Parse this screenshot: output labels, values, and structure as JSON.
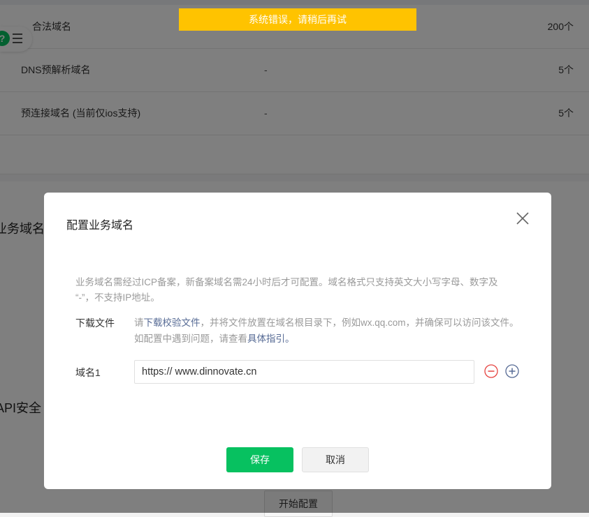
{
  "toast": {
    "text": "系统错误，请稍后再试",
    "color": "#ffc300"
  },
  "domain_table": {
    "rows": [
      {
        "name": "合法域名",
        "value": "",
        "count": "200个"
      },
      {
        "name": "DNS预解析域名",
        "value": "-",
        "count": "5个"
      },
      {
        "name": "预连接域名 (当前仅ios支持)",
        "value": "-",
        "count": "5个"
      }
    ]
  },
  "sections": {
    "business_domain_title": "业务域名",
    "api_security_title": "API安全"
  },
  "start_config_button": "开始配置",
  "help_float": {
    "icon": "question-icon",
    "menu_icon": "menu-icon"
  },
  "dialog": {
    "title": "配置业务域名",
    "notice_line1": "业务域名需经过ICP备案，新备案域名需24小时后才可配置。域名格式只支持英文大小写字母、数字及",
    "notice_line2": "“-”，不支持IP地址。",
    "download_label": "下载文件",
    "download_desc_prefix": "请",
    "download_link": "下载校验文件",
    "download_desc_middle": "，并将文件放置在域名根目录下，例如wx.qq.com，并确保可以访问该文件。如配置中遇到问题，请查看",
    "guide_link": "具体指引",
    "download_desc_suffix": "。",
    "domain_label": "域名1",
    "domain_value": "https:// www.dinnovate.cn",
    "save_label": "保存",
    "cancel_label": "取消",
    "accent_color": "#07c160",
    "remove_color": "#e64340",
    "add_color": "#576b95"
  }
}
